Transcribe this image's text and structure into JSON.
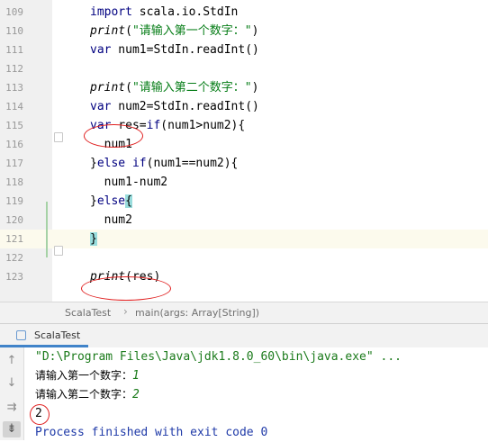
{
  "editor": {
    "lines": [
      {
        "num": "109",
        "parts": [
          {
            "t": "import",
            "c": "kw"
          },
          {
            "t": " scala.io.StdIn",
            "c": ""
          }
        ]
      },
      {
        "num": "110",
        "parts": [
          {
            "t": "print",
            "c": "fn"
          },
          {
            "t": "(",
            "c": ""
          },
          {
            "t": "\"请输入第一个数字：\"",
            "c": "str"
          },
          {
            "t": ")",
            "c": ""
          }
        ]
      },
      {
        "num": "111",
        "parts": [
          {
            "t": "var",
            "c": "kw"
          },
          {
            "t": " num1=StdIn.readInt()",
            "c": ""
          }
        ]
      },
      {
        "num": "112",
        "parts": []
      },
      {
        "num": "113",
        "parts": [
          {
            "t": "print",
            "c": "fn"
          },
          {
            "t": "(",
            "c": ""
          },
          {
            "t": "\"请输入第二个数字：\"",
            "c": "str"
          },
          {
            "t": ")",
            "c": ""
          }
        ]
      },
      {
        "num": "114",
        "parts": [
          {
            "t": "var",
            "c": "kw"
          },
          {
            "t": " num2=StdIn.readInt()",
            "c": ""
          }
        ]
      },
      {
        "num": "115",
        "parts": [
          {
            "t": "var",
            "c": "kw"
          },
          {
            "t": " res=",
            "c": ""
          },
          {
            "t": "if",
            "c": "kw"
          },
          {
            "t": "(num1>num2){",
            "c": ""
          }
        ]
      },
      {
        "num": "116",
        "parts": [
          {
            "t": "  num1",
            "c": ""
          }
        ]
      },
      {
        "num": "117",
        "parts": [
          {
            "t": "}",
            "c": ""
          },
          {
            "t": "else if",
            "c": "kw"
          },
          {
            "t": "(num1==num2){",
            "c": ""
          }
        ]
      },
      {
        "num": "118",
        "parts": [
          {
            "t": "  num1-num2",
            "c": ""
          }
        ]
      },
      {
        "num": "119",
        "parts": [
          {
            "t": "}",
            "c": ""
          },
          {
            "t": "else",
            "c": "kw"
          },
          {
            "t": "{",
            "c": "brace-hl"
          }
        ]
      },
      {
        "num": "120",
        "parts": [
          {
            "t": "  num2",
            "c": ""
          }
        ]
      },
      {
        "num": "121",
        "parts": [
          {
            "t": "}",
            "c": "brace-hl"
          }
        ]
      },
      {
        "num": "122",
        "parts": []
      },
      {
        "num": "123",
        "parts": [
          {
            "t": "print",
            "c": "fn"
          },
          {
            "t": "(res)",
            "c": ""
          }
        ]
      }
    ]
  },
  "breadcrumb": {
    "object": "ScalaTest",
    "separator": "›",
    "method": "main(args: Array[String])"
  },
  "run_panel": {
    "tab_label": "ScalaTest",
    "tools": [
      "arrow-up-icon",
      "arrow-down-icon",
      "soft-wrap-icon",
      "scroll-to-end-icon"
    ],
    "console": {
      "command": "\"D:\\Program Files\\Java\\jdk1.8.0_60\\bin\\java.exe\" ...",
      "prompt1": "请输入第一个数字：",
      "input1": "1",
      "prompt2": "请输入第二个数字：",
      "input2": "2",
      "output": "2",
      "exit_message": "Process finished with exit code 0"
    }
  },
  "colors": {
    "keyword": "#000080",
    "string": "#067d17",
    "annotation_oval": "#e02020",
    "tab_underline": "#4083c9"
  }
}
